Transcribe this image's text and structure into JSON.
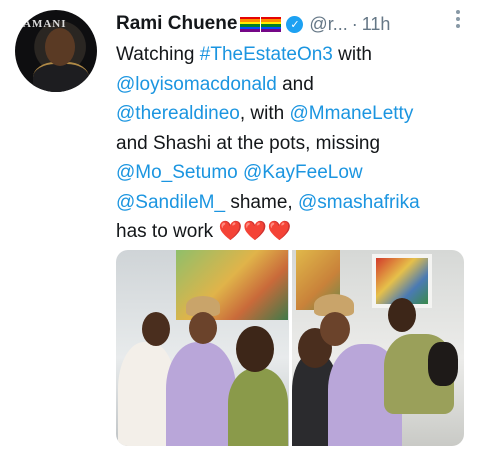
{
  "tweet": {
    "author_name": "Rami Chuene",
    "handle": "@r...",
    "separator": "·",
    "time": "11h",
    "text": {
      "t1": "Watching ",
      "l1": "#TheEstateOn3",
      "t2": " with ",
      "l2": "@loyisomacdonald",
      "t3": " and ",
      "l3": "@therealdineo",
      "t4": ", with ",
      "l4": "@MmaneLetty",
      "t5": " and Shashi at the pots, missing ",
      "l5": "@Mo_Setumo",
      "t6": " ",
      "l6": "@KayFeeLow",
      "t7": " ",
      "l7": "@SandileM_",
      "t8": " shame, ",
      "l8": "@smashafrika",
      "t9": " has to work ",
      "hearts": "❤️❤️❤️"
    },
    "avatar": {
      "magazine_text": "AMANI"
    },
    "icons": {
      "flags": [
        "rainbow-flag-icon",
        "rainbow-flag-icon"
      ],
      "verified": "verified-badge-icon",
      "more": "more-options-icon"
    },
    "colors": {
      "link": "#1b95e0",
      "meta": "#657786",
      "verified": "#1da1f2"
    }
  }
}
